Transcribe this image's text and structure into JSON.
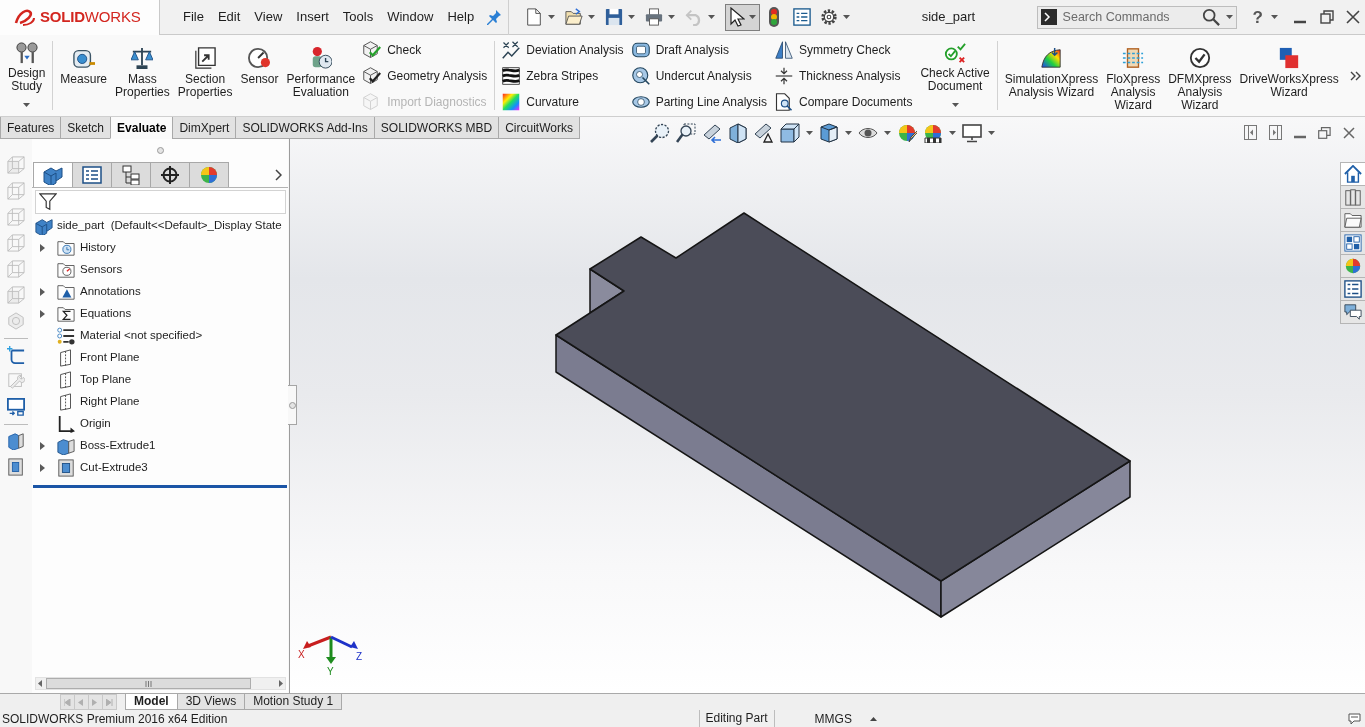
{
  "title_bar": {
    "logo": "**SOLID**WORKS",
    "menu": [
      "File",
      "Edit",
      "View",
      "Insert",
      "Tools",
      "Window",
      "Help"
    ],
    "undo": {
      "disabled": true
    },
    "select": {
      "selected": true
    },
    "document_title": "side_part",
    "search": {
      "placeholder": "Search Commands"
    },
    "help": "?"
  },
  "ribbon": {
    "groups": [
      [
        {
          "kind": "large",
          "label": "Design\nStudy",
          "dropdown": true
        }
      ],
      [
        {
          "kind": "large",
          "label": "Measure",
          "dropdown": false
        },
        {
          "kind": "large",
          "label": "Mass\nProperties",
          "dropdown": false
        },
        {
          "kind": "large",
          "label": "Section\nProperties",
          "dropdown": false
        },
        {
          "kind": "large",
          "label": "Sensor",
          "dropdown": false
        },
        {
          "kind": "large",
          "label": "Performance\nEvaluation",
          "dropdown": false
        },
        {
          "kind": "stack",
          "items": [
            {
              "label": "Check",
              "disabled": false
            },
            {
              "label": "Geometry Analysis",
              "disabled": false
            },
            {
              "label": "Import Diagnostics",
              "disabled": true
            }
          ]
        }
      ],
      [
        {
          "kind": "stack",
          "items": [
            {
              "label": "Deviation Analysis",
              "disabled": false
            },
            {
              "label": "Zebra Stripes",
              "disabled": false
            },
            {
              "label": "Curvature",
              "disabled": false
            }
          ]
        },
        {
          "kind": "stack",
          "items": [
            {
              "label": "Draft Analysis",
              "disabled": false
            },
            {
              "label": "Undercut Analysis",
              "disabled": false
            },
            {
              "label": "Parting Line Analysis",
              "disabled": false
            }
          ]
        },
        {
          "kind": "stack",
          "items": [
            {
              "label": "Symmetry Check",
              "disabled": false
            },
            {
              "label": "Thickness Analysis",
              "disabled": false
            },
            {
              "label": "Compare Documents",
              "disabled": false
            }
          ]
        },
        {
          "kind": "large",
          "label": "Check Active\nDocument",
          "dropdown": true
        }
      ],
      [
        {
          "kind": "large",
          "label": "SimulationXpress\nAnalysis Wizard",
          "dropdown": false
        },
        {
          "kind": "large",
          "label": "FloXpress\nAnalysis\nWizard",
          "dropdown": false
        },
        {
          "kind": "large",
          "label": "DFMXpress\nAnalysis\nWizard",
          "dropdown": false
        },
        {
          "kind": "large",
          "label": "DriveWorksXpress\nWizard",
          "dropdown": false
        }
      ]
    ]
  },
  "command_tabs": [
    {
      "label": "Features",
      "selected": false
    },
    {
      "label": "Sketch",
      "selected": false
    },
    {
      "label": "Evaluate",
      "selected": true
    },
    {
      "label": "DimXpert",
      "selected": false
    },
    {
      "label": "SOLIDWORKS Add-Ins",
      "selected": false
    },
    {
      "label": "SOLIDWORKS MBD",
      "selected": false
    },
    {
      "label": "CircuitWorks",
      "selected": false
    }
  ],
  "side_toolbar": [
    {
      "disabled": true
    },
    {
      "disabled": true
    },
    {
      "disabled": true
    },
    {
      "disabled": true
    },
    {
      "disabled": true
    },
    {
      "disabled": true
    },
    {
      "disabled": true
    },
    {
      "disabled": false
    },
    {
      "disabled": true
    },
    {
      "disabled": false
    },
    {
      "disabled": false
    },
    {
      "disabled": false
    }
  ],
  "feature_manager": {
    "tabs": [
      {
        "selected": true
      },
      {
        "selected": false
      },
      {
        "selected": false
      },
      {
        "selected": false
      },
      {
        "selected": false
      }
    ],
    "root": "side_part  (Default<<Default>_Display State",
    "tree": [
      {
        "label": "History",
        "expandable": true
      },
      {
        "label": "Sensors",
        "expandable": false
      },
      {
        "label": "Annotations",
        "expandable": true
      },
      {
        "label": "Equations",
        "expandable": true
      },
      {
        "label": "Material <not specified>",
        "expandable": false
      },
      {
        "label": "Front Plane",
        "expandable": false
      },
      {
        "label": "Top Plane",
        "expandable": false
      },
      {
        "label": "Right Plane",
        "expandable": false
      },
      {
        "label": "Origin",
        "expandable": false
      },
      {
        "label": "Boss-Extrude1",
        "expandable": true
      },
      {
        "label": "Cut-Extrude3",
        "expandable": true
      }
    ]
  },
  "viewport": {
    "triad": [
      {
        "label": "X",
        "color": "#c81e1e"
      },
      {
        "label": "Y",
        "color": "#1e8c1e"
      },
      {
        "label": "Z",
        "color": "#1e32c8"
      }
    ],
    "task_pane": [
      {
        "selected": true
      },
      {
        "selected": false
      },
      {
        "selected": false
      },
      {
        "selected": false
      },
      {
        "selected": false
      },
      {
        "selected": false
      },
      {
        "selected": false
      }
    ]
  },
  "model_tabs": [
    {
      "label": "Model",
      "selected": true
    },
    {
      "label": "3D Views",
      "selected": false
    },
    {
      "label": "Motion Study 1",
      "selected": false
    }
  ],
  "status_bar": {
    "edition": "SOLIDWORKS Premium 2016 x64 Edition",
    "mode": "Editing Part",
    "units": "MMGS"
  }
}
